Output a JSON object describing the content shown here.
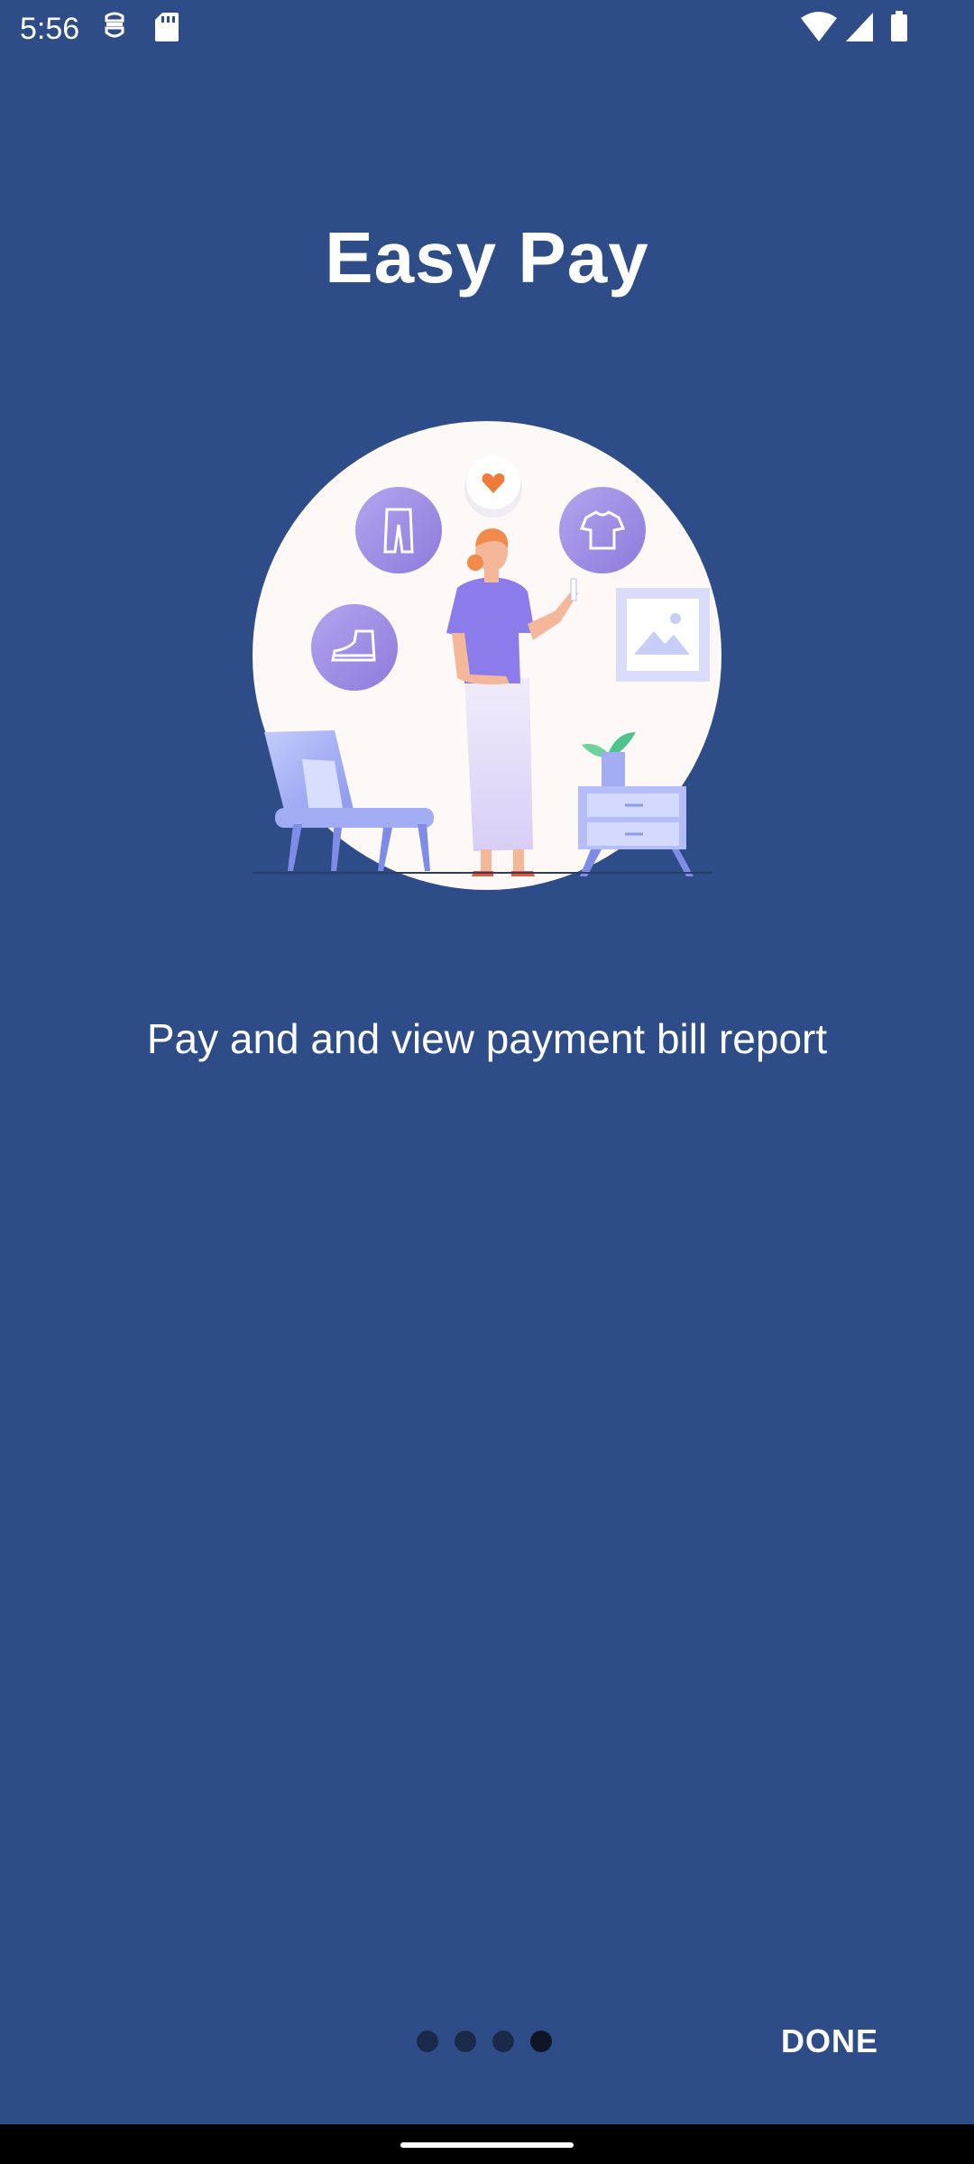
{
  "status_bar": {
    "time": "5:56",
    "left_icons": [
      "debug-icon",
      "sd-card-icon"
    ],
    "right_icons": [
      "wifi-icon",
      "cellular-signal-icon",
      "battery-icon"
    ]
  },
  "page": {
    "title": "Easy Pay",
    "description": "Pay and and view payment bill report",
    "illustration": "woman-shopping-illustration"
  },
  "pager": {
    "total_pages": 4,
    "current_page": 4
  },
  "footer": {
    "done_label": "DONE"
  },
  "colors": {
    "background": "#2E4D88",
    "text": "#FFFFFF",
    "dot_inactive": "#1B2A4A",
    "dot_active": "#0D1526",
    "nav_bar": "#000000"
  }
}
